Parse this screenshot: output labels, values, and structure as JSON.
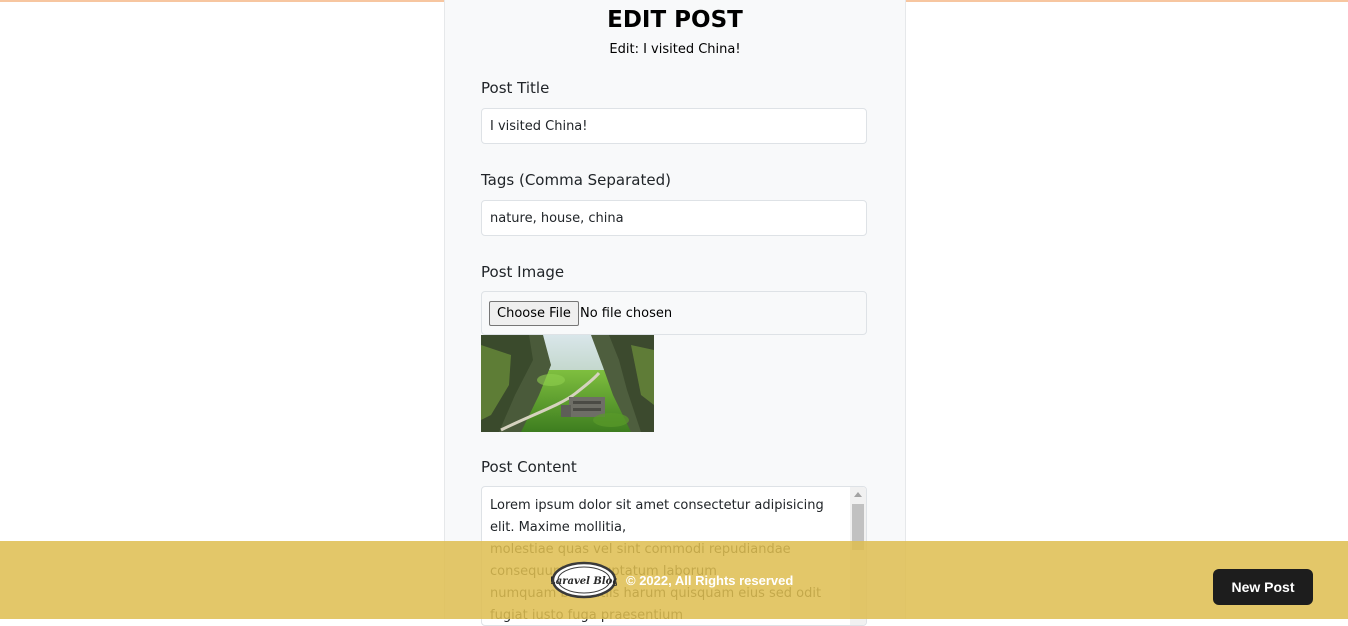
{
  "page": {
    "title": "EDIT POST",
    "subtitle": "Edit: I visited China!"
  },
  "form": {
    "title_label": "Post Title",
    "title_value": "I visited China!",
    "tags_label": "Tags (Comma Separated)",
    "tags_value": "nature, house, china",
    "image_label": "Post Image",
    "choose_file_label": "Choose File",
    "no_file_text": "No file chosen",
    "content_label": "Post Content",
    "content_value": "Lorem ipsum dolor sit amet consectetur adipisicing elit. Maxime mollitia,\nmolestiae quas vel sint commodi repudiandae consequuntur voluptatum laborum\nnumquam blanditiis harum quisquam eius sed odit fugiat iusto fuga praesentium"
  },
  "footer": {
    "logo_text": "Laravel Blog",
    "copyright": "© 2022, All Rights reserved",
    "new_post_label": "New Post"
  },
  "colors": {
    "footer_bg": "#e0c35f",
    "button_bg": "#1d1d1d",
    "panel_bg": "#f8f9fa"
  }
}
